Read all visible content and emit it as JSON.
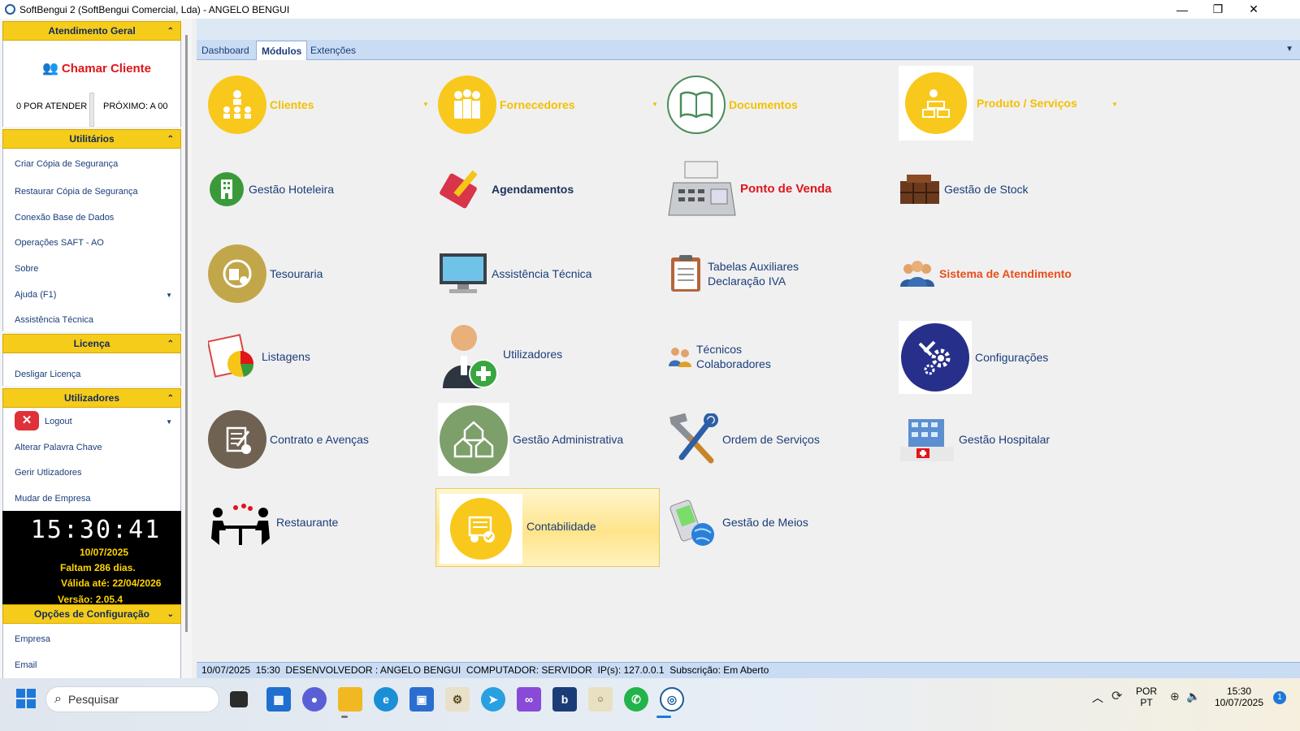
{
  "window": {
    "title": "SoftBengui 2  (SoftBengui Comercial, Lda) - ANGELO BENGUI"
  },
  "sidebar": {
    "atendimento": {
      "header": "Atendimento Geral",
      "chamar": "Chamar Cliente",
      "por_atender": "0 POR ATENDER",
      "proximo": "PRÓXIMO: A 00"
    },
    "utilitarios": {
      "header": "Utilitários",
      "items": [
        "Criar Cópia de Segurança",
        "Restaurar Cópia de Segurança",
        "Conexão Base de Dados",
        "Operações SAFT - AO",
        "Sobre",
        "Ajuda (F1)",
        "Assistência Técnica"
      ]
    },
    "licenca": {
      "header": "Licença",
      "items": [
        "Desligar Licença"
      ]
    },
    "utilizadores": {
      "header": "Utilizadores",
      "items": [
        "Logout",
        "Alterar Palavra Chave",
        "Gerir Utlizadores",
        "Mudar de Empresa"
      ]
    },
    "clock": {
      "time": "15:30:41",
      "date": "10/07/2025",
      "faltam": "Faltam 286 dias.",
      "valida": "Válida até: 22/04/2026",
      "versao": "Versão: 2.05.4"
    },
    "config": {
      "header": "Opções de Configuração",
      "items": [
        "Empresa",
        "Email"
      ]
    }
  },
  "tabs": [
    "Dashboard",
    "Módulos",
    "Extenções"
  ],
  "modules": {
    "clientes": "Clientes",
    "fornecedores": "Fornecedores",
    "documentos": "Documentos",
    "produto": "Produto / Serviços",
    "hoteleira": "Gestão Hoteleira",
    "agendamentos": "Agendamentos",
    "ponto_venda": "Ponto de Venda",
    "stock": "Gestão de Stock",
    "tesouraria": "Tesouraria",
    "assistencia": "Assistência Técnica",
    "tabelas_1": "Tabelas Auxiliares",
    "tabelas_2": "Declaração IVA",
    "sistema": "Sistema de Atendimento",
    "listagens": "Listagens",
    "utilizadores": "Utilizadores",
    "tecnicos_1": "Técnicos",
    "tecnicos_2": "Colaboradores",
    "configuracoes": "Configurações",
    "contrato": "Contrato e Avenças",
    "administrativa": "Gestão Administrativa",
    "ordem": "Ordem de Serviços",
    "hospitalar": "Gestão Hospitalar",
    "restaurante": "Restaurante",
    "contabilidade": "Contabilidade",
    "meios": "Gestão de Meios"
  },
  "status": {
    "text": "10/07/2025  15:30  DESENVOLVEDOR : ANGELO BENGUI  COMPUTADOR: SERVIDOR  IP(s): 127.0.0.1  Subscrição: Em Aberto"
  },
  "taskbar": {
    "search": "Pesquisar",
    "lang1": "POR",
    "lang2": "PT",
    "time": "15:30",
    "date": "10/07/2025",
    "notif": "1"
  },
  "colors": {
    "gold": "#f8c81c",
    "accent_blue": "#1a3d7a",
    "red": "#e0151a"
  }
}
